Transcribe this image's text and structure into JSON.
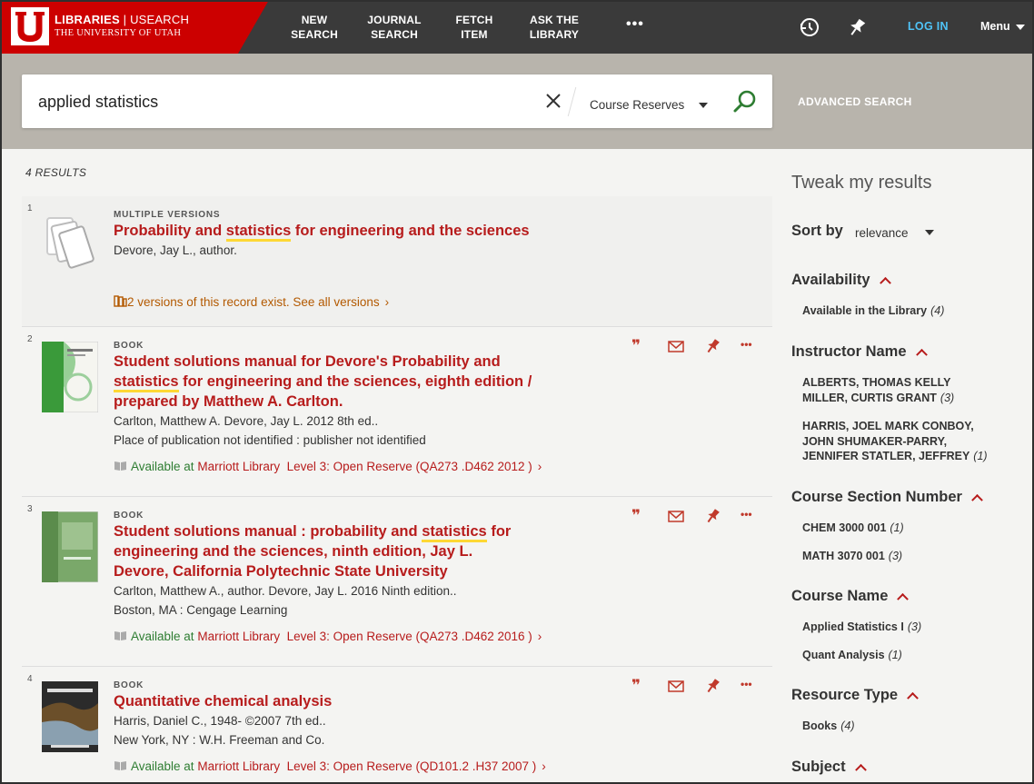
{
  "header": {
    "brand": {
      "title_main": "LIBRARIES",
      "title_sep": " | ",
      "title_app": "USEARCH",
      "subtitle": "THE UNIVERSITY OF UTAH"
    },
    "nav": [
      {
        "line1": "NEW",
        "line2": "SEARCH"
      },
      {
        "line1": "JOURNAL",
        "line2": "SEARCH"
      },
      {
        "line1": "FETCH",
        "line2": "ITEM"
      },
      {
        "line1": "ASK THE",
        "line2": "LIBRARY"
      }
    ],
    "more": "•••",
    "history_icon": "history-icon",
    "pin_icon": "pin-icon",
    "login": "LOG IN",
    "menu": "Menu"
  },
  "search": {
    "query": "applied statistics",
    "scope": "Course Reserves",
    "advanced": "ADVANCED SEARCH"
  },
  "results": {
    "count": "4 RESULTS",
    "items": [
      {
        "num": "1",
        "type": "MULTIPLE VERSIONS",
        "title_pre": "Probability and ",
        "title_hl": "statistics",
        "title_post": " for engineering and the sciences",
        "line1": "Devore, Jay L., author.",
        "versions": "2 versions of this record exist. See all versions"
      },
      {
        "num": "2",
        "type": "BOOK",
        "title_pre": "Student solutions manual for Devore's Probability and ",
        "title_hl": "statistics",
        "title_post": " for engineering and the sciences, eighth edition / prepared by Matthew A. Carlton.",
        "line1": "Carlton, Matthew A. Devore, Jay L. 2012 8th ed..",
        "line2": "Place of publication not identified : publisher not identified",
        "avail_prefix": "Available at",
        "avail_lib": "Marriott Library",
        "avail_loc": "Level 3: Open Reserve (QA273 .D462 2012 )"
      },
      {
        "num": "3",
        "type": "BOOK",
        "title_pre": "Student solutions manual : probability and ",
        "title_hl": "statistics",
        "title_post": " for engineering and the sciences, ninth edition, Jay L. Devore, California Polytechnic State University",
        "line1": "Carlton, Matthew A., author. Devore, Jay L. 2016 Ninth edition..",
        "line2": "Boston, MA : Cengage Learning",
        "avail_prefix": "Available at",
        "avail_lib": "Marriott Library",
        "avail_loc": "Level 3: Open Reserve (QA273 .D462 2016 )"
      },
      {
        "num": "4",
        "type": "BOOK",
        "title_pre": "Quantitative chemical analysis",
        "line1": "Harris, Daniel C., 1948- ©2007 7th ed..",
        "line2": "New York, NY : W.H. Freeman and Co.",
        "avail_prefix": "Available at",
        "avail_lib": "Marriott Library",
        "avail_loc": "Level 3: Open Reserve (QD101.2 .H37 2007 )"
      }
    ]
  },
  "sidebar": {
    "title": "Tweak my results",
    "sort_label": "Sort by",
    "sort_value": "relevance",
    "facets": {
      "availability": {
        "title": "Availability",
        "items": [
          {
            "label": "Available in the Library",
            "count": "(4)"
          }
        ]
      },
      "instructor": {
        "title": "Instructor Name",
        "items": [
          {
            "label": "ALBERTS, THOMAS KELLY MILLER, CURTIS GRANT",
            "count": "(3)"
          },
          {
            "label": "HARRIS, JOEL MARK CONBOY, JOHN SHUMAKER-PARRY, JENNIFER STATLER, JEFFREY",
            "count": "(1)"
          }
        ]
      },
      "section": {
        "title": "Course Section Number",
        "items": [
          {
            "label": "CHEM 3000 001",
            "count": "(1)"
          },
          {
            "label": "MATH 3070 001",
            "count": "(3)"
          }
        ]
      },
      "course": {
        "title": "Course Name",
        "items": [
          {
            "label": "Applied Statistics I",
            "count": "(3)"
          },
          {
            "label": "Quant Analysis",
            "count": "(1)"
          }
        ]
      },
      "resource": {
        "title": "Resource Type",
        "items": [
          {
            "label": "Books",
            "count": "(4)"
          }
        ]
      },
      "subject": {
        "title": "Subject"
      }
    }
  }
}
